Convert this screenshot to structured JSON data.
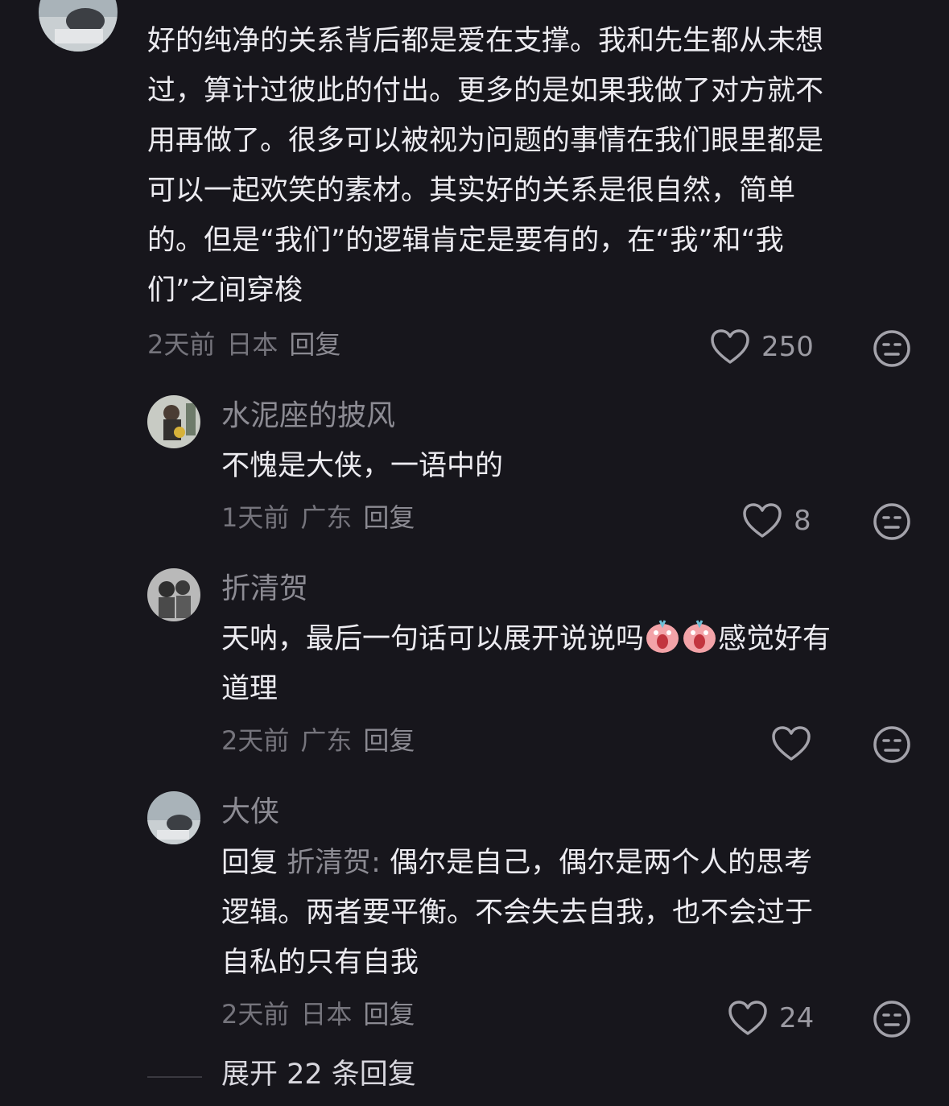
{
  "comment_main": {
    "lines": [
      "好的纯净的关系背后都是爱在支撑。我和先生都从未想",
      "过，算计过彼此的付出。更多的是如果我做了对方就不",
      "用再做了。很多可以被视为问题的事情在我们眼里都是",
      "可以一起欢笑的素材。其实好的关系是很自然，简单",
      "的。但是“我们”的逻辑肯定是要有的，在“我”和“我",
      "们”之间穿梭"
    ],
    "time": "2天前",
    "location": "日本",
    "reply_label": "回复",
    "likes": "250"
  },
  "replies": [
    {
      "username": "水泥座的披风",
      "lines": [
        "不愧是大侠，一语中的"
      ],
      "time": "1天前",
      "location": "广东",
      "reply_label": "回复",
      "likes": "8"
    },
    {
      "username": "折清贺",
      "line1_a": "天呐，最后一句话可以展开说说吗",
      "line1_b": "感觉好有",
      "line2": "道理",
      "emoji": "screaming-emoji",
      "time": "2天前",
      "location": "广东",
      "reply_label": "回复",
      "likes": ""
    },
    {
      "username": "大侠",
      "reply_prefix": "回复",
      "reply_target": "折清贺:",
      "line1_rest": "偶尔是自己，偶尔是两个人的思考",
      "line2": "逻辑。两者要平衡。不会失去自我，也不会过于",
      "line3": "自私的只有自我",
      "time": "2天前",
      "location": "日本",
      "reply_label": "回复",
      "likes": "24"
    }
  ],
  "expand_label": "展开 22 条回复",
  "icons": {
    "like": "heart-outline-icon",
    "dislike": "meh-face-icon"
  },
  "colors": {
    "background": "#17161c",
    "text": "#ecebf0",
    "secondary": "#8c8b93"
  }
}
